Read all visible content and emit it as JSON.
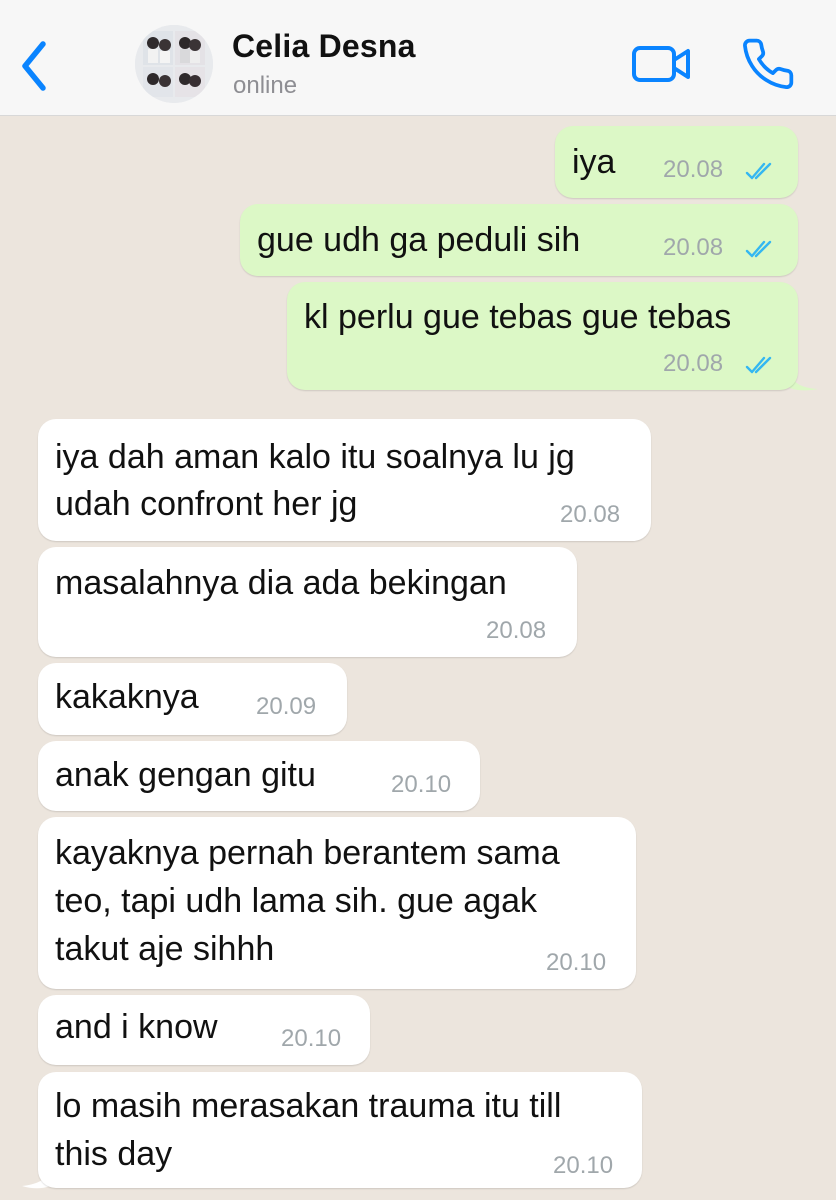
{
  "header": {
    "contact_name": "Celia Desna",
    "status": "online",
    "back_icon": "chevron-left-icon",
    "video_icon": "video-camera-icon",
    "call_icon": "phone-icon",
    "accent_color": "#0a84ff"
  },
  "colors": {
    "background": "#ece5dd",
    "outgoing_bubble": "#dcf8c6",
    "incoming_bubble": "#ffffff",
    "read_ticks": "#34b7f1"
  },
  "messages": [
    {
      "direction": "out",
      "lines": [
        "iya"
      ],
      "time": "20.08",
      "read": true
    },
    {
      "direction": "out",
      "lines": [
        "gue udh ga peduli sih"
      ],
      "time": "20.08",
      "read": true
    },
    {
      "direction": "out",
      "lines": [
        "kl perlu gue tebas gue tebas"
      ],
      "time": "20.08",
      "read": true
    },
    {
      "direction": "in",
      "lines": [
        "iya dah aman kalo itu soalnya lu jg",
        "udah confront her jg"
      ],
      "time": "20.08"
    },
    {
      "direction": "in",
      "lines": [
        "masalahnya dia ada bekingan"
      ],
      "time": "20.08"
    },
    {
      "direction": "in",
      "lines": [
        "kakaknya"
      ],
      "time": "20.09"
    },
    {
      "direction": "in",
      "lines": [
        "anak gengan gitu"
      ],
      "time": "20.10"
    },
    {
      "direction": "in",
      "lines": [
        "kayaknya pernah berantem sama",
        "teo, tapi udh lama sih. gue agak",
        "takut aje sihhh"
      ],
      "time": "20.10"
    },
    {
      "direction": "in",
      "lines": [
        "and i know"
      ],
      "time": "20.10"
    },
    {
      "direction": "in",
      "lines": [
        "lo masih merasakan trauma itu till",
        "this day"
      ],
      "time": "20.10"
    }
  ]
}
